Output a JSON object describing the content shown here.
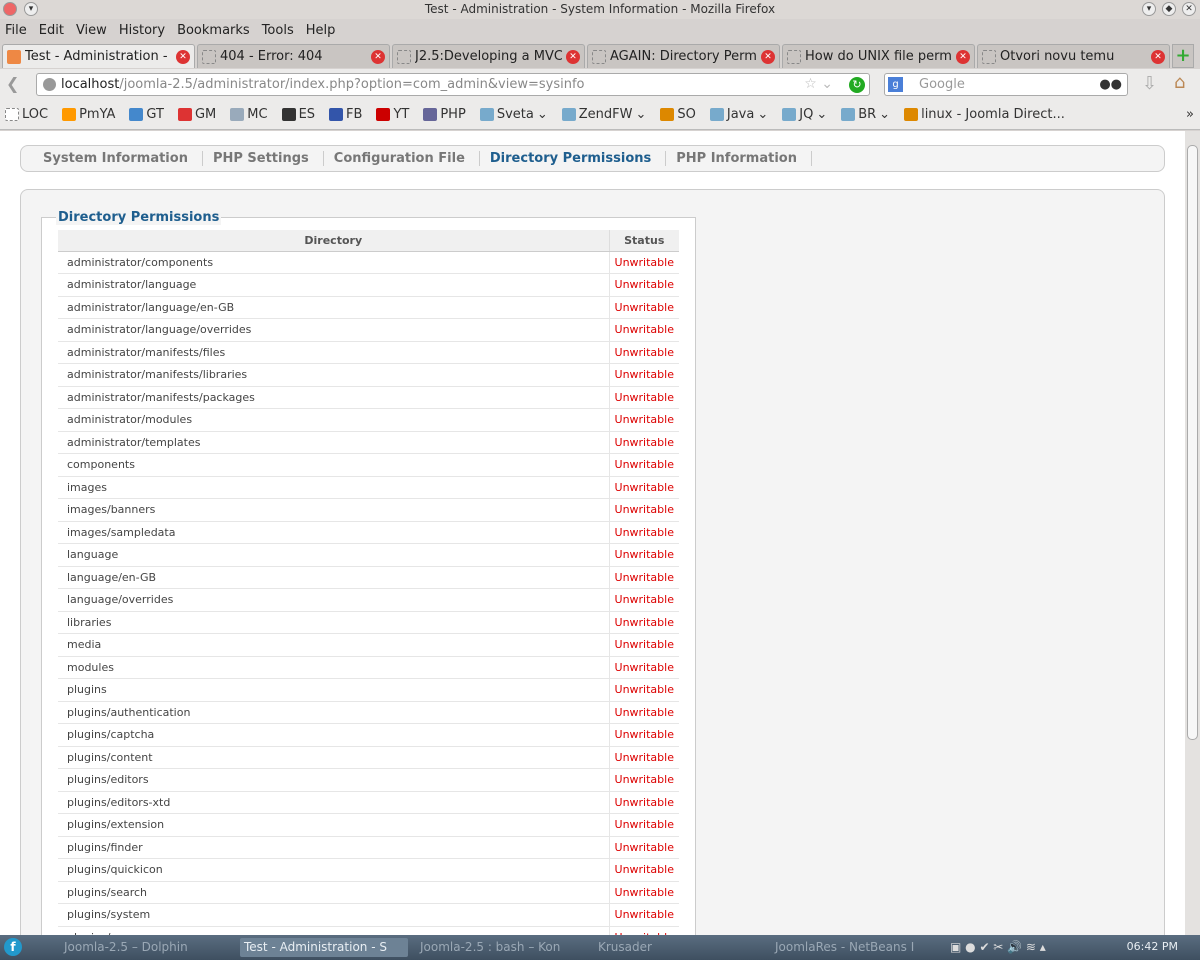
{
  "window": {
    "title": "Test - Administration - System Information - Mozilla Firefox"
  },
  "menu": [
    "File",
    "Edit",
    "View",
    "History",
    "Bookmarks",
    "Tools",
    "Help"
  ],
  "tabs": [
    "Test - Administration - ...",
    "404 - Error: 404",
    "J2.5:Developing a MVC...",
    "AGAIN: Directory Perm...",
    "How do UNIX file permi...",
    "Otvori novu temu"
  ],
  "url": {
    "host": "localhost",
    "path": "/joomla-2.5/administrator/index.php?option=com_admin&view=sysinfo"
  },
  "search": {
    "placeholder": "Google"
  },
  "bookmarks": [
    "LOC",
    "PmYA",
    "GT",
    "GM",
    "MC",
    "ES",
    "FB",
    "YT",
    "PHP",
    "Sveta",
    "ZendFW",
    "SO",
    "Java",
    "JQ",
    "BR",
    "linux - Joomla Direct..."
  ],
  "subnav": [
    "System Information",
    "PHP Settings",
    "Configuration File",
    "Directory Permissions",
    "PHP Information"
  ],
  "section_title": "Directory Permissions",
  "table": {
    "headers": [
      "Directory",
      "Status"
    ],
    "rows": [
      "administrator/components",
      "administrator/language",
      "administrator/language/en-GB",
      "administrator/language/overrides",
      "administrator/manifests/files",
      "administrator/manifests/libraries",
      "administrator/manifests/packages",
      "administrator/modules",
      "administrator/templates",
      "components",
      "images",
      "images/banners",
      "images/sampledata",
      "language",
      "language/en-GB",
      "language/overrides",
      "libraries",
      "media",
      "modules",
      "plugins",
      "plugins/authentication",
      "plugins/captcha",
      "plugins/content",
      "plugins/editors",
      "plugins/editors-xtd",
      "plugins/extension",
      "plugins/finder",
      "plugins/quickicon",
      "plugins/search",
      "plugins/system",
      "plugins/user"
    ],
    "status": "Unwritable"
  },
  "taskbar": {
    "tasks": [
      "Joomla-2.5 – Dolphin",
      "Test - Administration - S",
      "Joomla-2.5 : bash – Kon",
      "Krusader",
      "JoomlaRes - NetBeans I"
    ],
    "clock": "06:42 PM"
  }
}
